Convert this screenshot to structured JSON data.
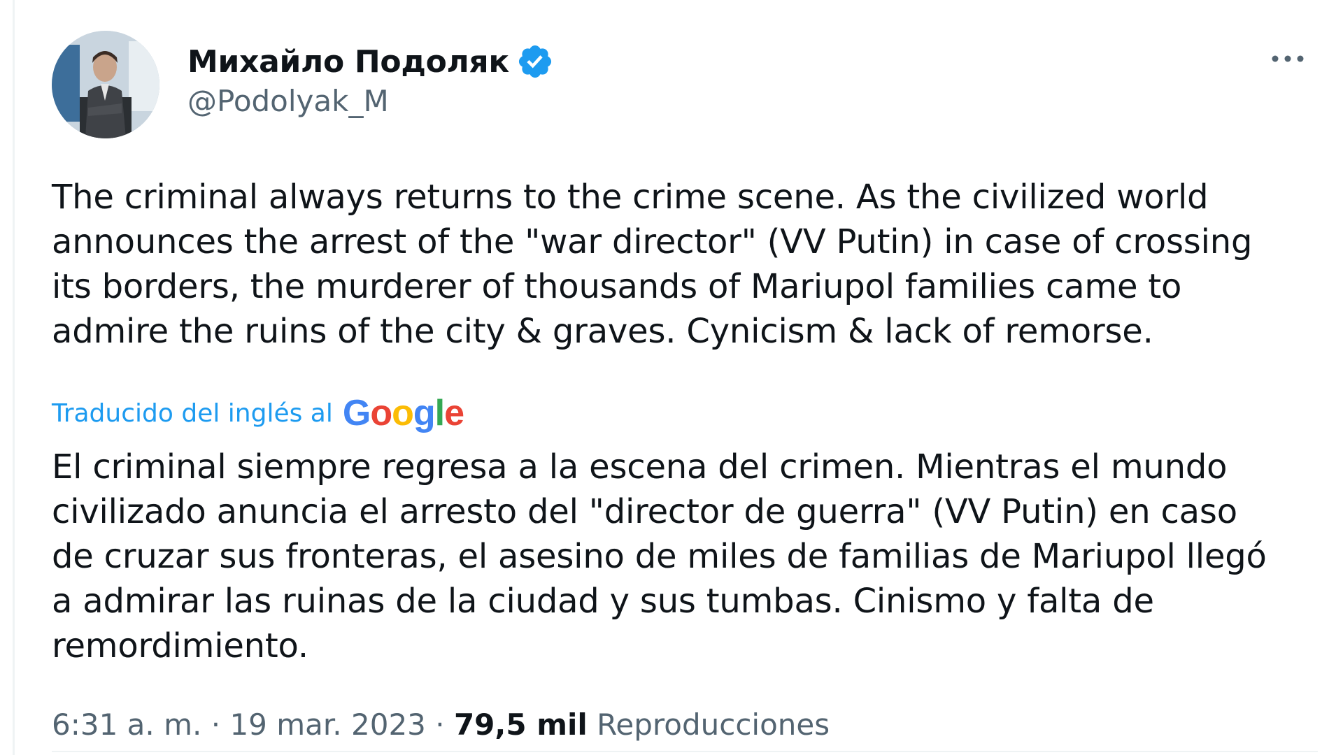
{
  "author": {
    "name": "Михайло Подоляк",
    "handle": "@Podolyak_M",
    "verified": true,
    "verified_color": "#1d9bf0"
  },
  "tweet": {
    "text": "The criminal always returns to the crime scene. As the civilized world\nannounces the arrest of the \"war director\" (VV Putin) in case of crossing\nits borders, the murderer of thousands of Mariupol families came to\nadmire the ruins of the city & graves. Cynicism & lack of remorse.",
    "translation_label": "Traducido del inglés al",
    "translation_provider": [
      "G",
      "o",
      "o",
      "g",
      "l",
      "e"
    ],
    "translation_text": "El criminal siempre regresa a la escena del crimen. Mientras el mundo\ncivilizado anuncia el arresto del \"director de guerra\" (VV Putin) en caso\nde cruzar sus fronteras, el asesino de miles de familias de Mariupol llegó\na admirar las ruinas de la ciudad y sus tumbas. Cinismo y falta de\nremordimiento."
  },
  "meta": {
    "time": "6:31 a. m.",
    "separator": " · ",
    "date": "19 mar. 2023",
    "views_count": "79,5 mil",
    "views_label": "Reproducciones"
  },
  "icons": {
    "more": "more-horizontal-icon",
    "verified": "verified-badge-icon"
  },
  "colors": {
    "text_primary": "#0f1419",
    "text_secondary": "#536471",
    "link": "#1d9bf0"
  }
}
